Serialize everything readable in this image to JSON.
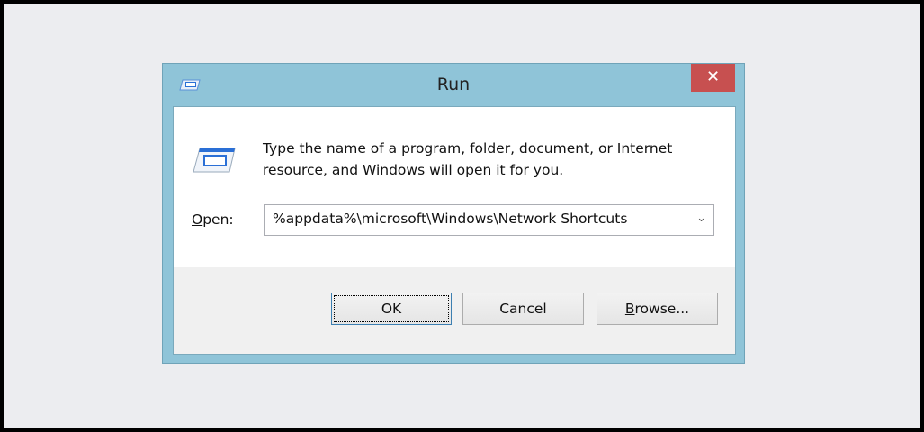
{
  "window": {
    "title": "Run",
    "close_label": "✕",
    "icon": "run-icon"
  },
  "dialog": {
    "message_line1": "Type the name of a program, folder, document, or Internet",
    "message_line2": "resource, and Windows will open it for you.",
    "open_label_mnemonic": "O",
    "open_label_rest": "pen:",
    "open_value": "%appdata%\\microsoft\\Windows\\Network Shortcuts",
    "dropdown_icon": "chevron-down-icon"
  },
  "buttons": {
    "ok": "OK",
    "cancel": "Cancel",
    "browse_mnemonic": "B",
    "browse_rest": "rowse..."
  },
  "colors": {
    "titlebar": "#8fc4d8",
    "close": "#c75050"
  }
}
